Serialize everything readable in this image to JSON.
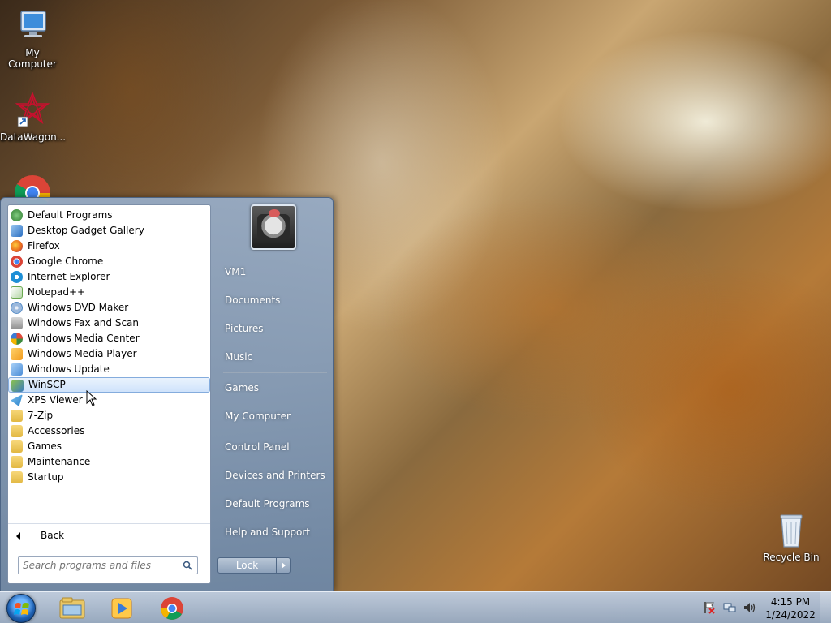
{
  "desktop": {
    "icons": [
      {
        "label": "My Computer",
        "icon": "computer-icon"
      },
      {
        "label": "DataWagon...",
        "icon": "datawagon-shortcut-icon"
      },
      {
        "label": "",
        "icon": "chrome-icon"
      },
      {
        "label": "Recycle Bin",
        "icon": "recycle-bin-icon"
      }
    ]
  },
  "start_menu": {
    "programs": [
      {
        "label": "Default Programs",
        "icon": "default-programs-icon",
        "color": "#3a8a3a"
      },
      {
        "label": "Desktop Gadget Gallery",
        "icon": "gadget-icon",
        "color": "#2b6fc2"
      },
      {
        "label": "Firefox",
        "icon": "firefox-icon",
        "color": "#e8661c"
      },
      {
        "label": "Google Chrome",
        "icon": "chrome-icon",
        "color": "#dd4b39"
      },
      {
        "label": "Internet Explorer",
        "icon": "ie-icon",
        "color": "#1e8fd6"
      },
      {
        "label": "Notepad++",
        "icon": "notepad-icon",
        "color": "#6aa84f"
      },
      {
        "label": "Windows DVD Maker",
        "icon": "dvd-maker-icon",
        "color": "#5b8fc7"
      },
      {
        "label": "Windows Fax and Scan",
        "icon": "fax-icon",
        "color": "#8e8e8e"
      },
      {
        "label": "Windows Media Center",
        "icon": "media-center-icon",
        "color": "#3d8b3d"
      },
      {
        "label": "Windows Media Player",
        "icon": "media-player-icon",
        "color": "#f29c1f"
      },
      {
        "label": "Windows Update",
        "icon": "windows-update-icon",
        "color": "#4c8ed8"
      },
      {
        "label": "WinSCP",
        "icon": "winscp-icon",
        "color": "#3b7bbf"
      },
      {
        "label": "XPS Viewer",
        "icon": "xps-viewer-icon",
        "color": "#2a80c9"
      },
      {
        "label": "7-Zip",
        "icon": "folder-icon",
        "color": "#e2b842"
      },
      {
        "label": "Accessories",
        "icon": "folder-icon",
        "color": "#e2b842"
      },
      {
        "label": "Games",
        "icon": "folder-icon",
        "color": "#e2b842"
      },
      {
        "label": "Maintenance",
        "icon": "folder-icon",
        "color": "#e2b842"
      },
      {
        "label": "Startup",
        "icon": "folder-icon",
        "color": "#e2b842"
      }
    ],
    "selected_program": "WinSCP",
    "back_label": "Back",
    "search": {
      "placeholder": "Search programs and files"
    },
    "right": {
      "user": "VM1",
      "items": [
        "Documents",
        "Pictures",
        "Music",
        "Games",
        "My Computer",
        "Control Panel",
        "Devices and Printers",
        "Default Programs",
        "Help and Support"
      ],
      "lock_label": "Lock"
    }
  },
  "taskbar": {
    "pinned": [
      "explorer-icon",
      "media-player-icon",
      "chrome-icon"
    ],
    "tray_icons": [
      "action-center-flag-icon",
      "network-icon",
      "volume-icon"
    ],
    "time": "4:15 PM",
    "date": "1/24/2022"
  }
}
